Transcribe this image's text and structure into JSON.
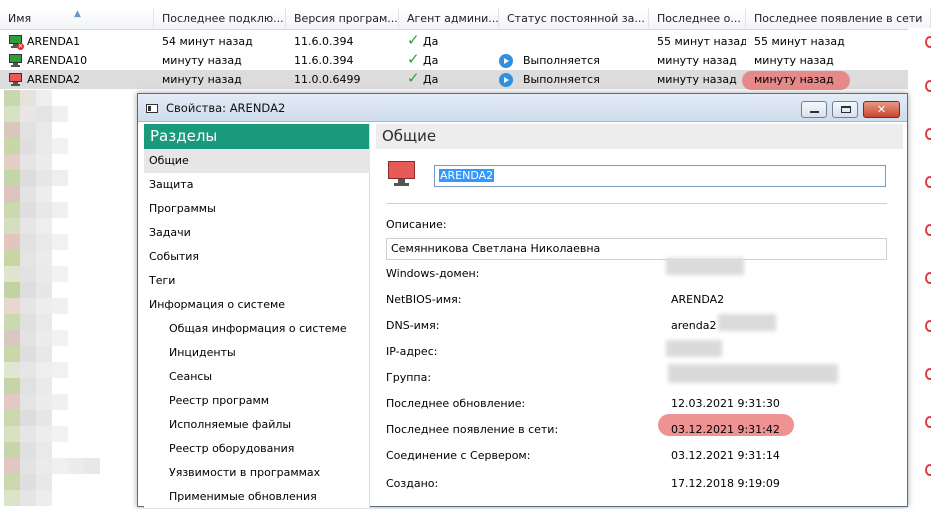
{
  "grid": {
    "columns": [
      "Имя",
      "Последнее подклю...",
      "Версия програм...",
      "Агент админи...",
      "Статус постоянной за...",
      "Последнее о...",
      "Последнее появление в сети"
    ],
    "rows": [
      {
        "name": "ARENDA1",
        "last_connect": "54 минут назад",
        "version": "11.6.0.394",
        "agent": "Да",
        "status": "",
        "last_update": "55 минут назад",
        "last_seen": "55 минут назад",
        "icon_color": "#2e9e3a"
      },
      {
        "name": "ARENDA10",
        "last_connect": "минуту назад",
        "version": "11.6.0.394",
        "agent": "Да",
        "status": "Выполняется",
        "last_update": "минуту назад",
        "last_seen": "минуту назад",
        "icon_color": "#2e9e3a"
      },
      {
        "name": "ARENDA2",
        "last_connect": "минуту назад",
        "version": "11.0.0.6499",
        "agent": "Да",
        "status": "Выполняется",
        "last_update": "минуту назад",
        "last_seen": "минуту назад",
        "icon_color": "#e85a5a"
      }
    ]
  },
  "window": {
    "title": "Свойства: ARENDA2",
    "close_glyph": "✕"
  },
  "sidebar": {
    "heading": "Разделы",
    "items": [
      {
        "label": "Общие"
      },
      {
        "label": "Защита"
      },
      {
        "label": "Программы"
      },
      {
        "label": "Задачи"
      },
      {
        "label": "События"
      },
      {
        "label": "Теги"
      },
      {
        "label": "Информация о системе"
      },
      {
        "label": "Общая информация о системе"
      },
      {
        "label": "Инциденты"
      },
      {
        "label": "Сеансы"
      },
      {
        "label": "Реестр программ"
      },
      {
        "label": "Исполняемые файлы"
      },
      {
        "label": "Реестр оборудования"
      },
      {
        "label": "Уязвимости в программах"
      },
      {
        "label": "Применимые обновления"
      }
    ]
  },
  "general": {
    "heading": "Общие",
    "computer_name": "ARENDA2",
    "description_label": "Описание:",
    "description_value": "Семянникова Светлана Николаевна",
    "fields": [
      {
        "label": "Windows-домен:",
        "value": ""
      },
      {
        "label": "NetBIOS-имя:",
        "value": "ARENDA2"
      },
      {
        "label": "DNS-имя:",
        "value": "arenda2"
      },
      {
        "label": "IP-адрес:",
        "value": ""
      },
      {
        "label": "Группа:",
        "value": ""
      },
      {
        "label": "Последнее обновление:",
        "value": "12.03.2021 9:31:30"
      },
      {
        "label": "Последнее появление в сети:",
        "value": "03.12.2021 9:31:42"
      },
      {
        "label": "Соединение с Сервером:",
        "value": "03.12.2021 9:31:14"
      },
      {
        "label": "Создано:",
        "value": "17.12.2018 9:19:09"
      }
    ]
  },
  "colors": {
    "accent_header": "#1a9a7c",
    "highlight_mark": "#e86e6e",
    "ok_check": "#28a03c",
    "running_icon": "#2f8fe0"
  }
}
